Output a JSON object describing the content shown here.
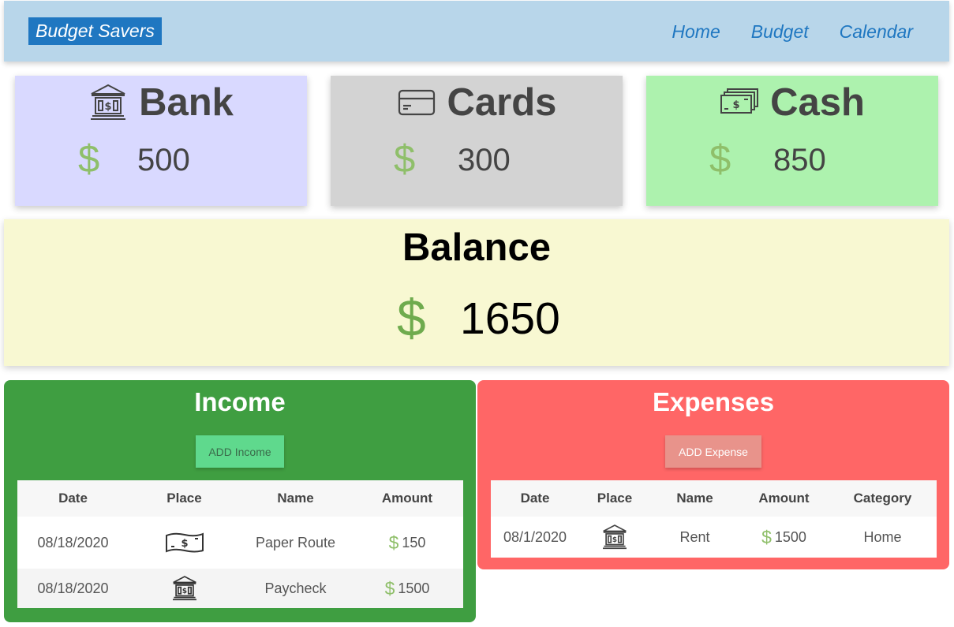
{
  "nav": {
    "brand": "Budget Savers",
    "links": [
      "Home",
      "Budget",
      "Calendar"
    ]
  },
  "accounts": [
    {
      "title": "Bank",
      "icon": "bank-icon",
      "currency": "$",
      "amount": "500",
      "bg": "#d9d9ff"
    },
    {
      "title": "Cards",
      "icon": "credit-card-icon",
      "currency": "$",
      "amount": "300",
      "bg": "#d3d3d3"
    },
    {
      "title": "Cash",
      "icon": "cash-icon",
      "currency": "$",
      "amount": "850",
      "bg": "#adf2ae"
    }
  ],
  "balance": {
    "title": "Balance",
    "currency": "$",
    "amount": "1650"
  },
  "income": {
    "title": "Income",
    "add_label": "ADD Income",
    "bg": "#3f9e41",
    "columns": [
      "Date",
      "Place",
      "Name",
      "Amount"
    ],
    "rows": [
      {
        "date": "08/18/2020",
        "place_icon": "cash-icon",
        "name": "Paper Route",
        "currency": "$",
        "amount": "150"
      },
      {
        "date": "08/18/2020",
        "place_icon": "bank-icon",
        "name": "Paycheck",
        "currency": "$",
        "amount": "1500"
      }
    ]
  },
  "expenses": {
    "title": "Expenses",
    "add_label": "ADD Expense",
    "bg": "#ff6666",
    "columns": [
      "Date",
      "Place",
      "Name",
      "Amount",
      "Category"
    ],
    "rows": [
      {
        "date": "08/1/2020",
        "place_icon": "bank-icon",
        "name": "Rent",
        "currency": "$",
        "amount": "1500",
        "category": "Home"
      }
    ]
  }
}
